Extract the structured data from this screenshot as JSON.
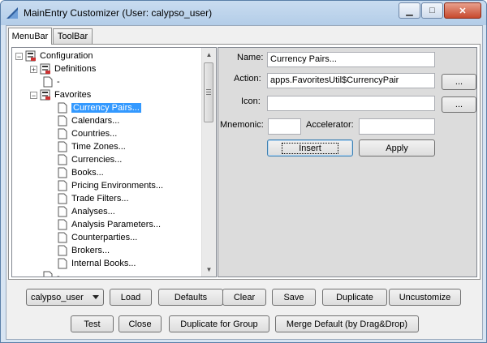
{
  "window": {
    "title": "MainEntry Customizer (User: calypso_user)",
    "minimize_glyph": "▁",
    "maximize_glyph": "□",
    "close_glyph": "✕"
  },
  "tabs": [
    {
      "label": "MenuBar"
    },
    {
      "label": "ToolBar"
    }
  ],
  "tree": {
    "root": "Configuration",
    "definitions": "Definitions",
    "separator": "-",
    "favorites": "Favorites",
    "favorites_items": [
      "Currency Pairs...",
      "Calendars...",
      "Countries...",
      "Time Zones...",
      "Currencies...",
      "Books...",
      "Pricing Environments...",
      "Trade Filters...",
      "Analyses...",
      "Analysis Parameters...",
      "Counterparties...",
      "Brokers...",
      "Internal Books..."
    ],
    "trailing_item": "-"
  },
  "editor": {
    "name_label": "Name:",
    "name_value": "Currency Pairs...",
    "action_label": "Action:",
    "action_value": "apps.FavoritesUtil$CurrencyPair",
    "action_browse": "...",
    "icon_label": "Icon:",
    "icon_value": "",
    "icon_browse": "...",
    "mnemonic_label": "Mnemonic:",
    "mnemonic_value": "",
    "accelerator_label": "Accelerator:",
    "accelerator_value": "",
    "insert_label": "Insert",
    "apply_label": "Apply"
  },
  "bottom": {
    "user_select": "calypso_user",
    "load": "Load",
    "defaults": "Defaults",
    "clear": "Clear",
    "save": "Save",
    "duplicate": "Duplicate",
    "uncustomize": "Uncustomize",
    "test": "Test",
    "close": "Close",
    "duplicate_group": "Duplicate for Group",
    "merge_default": "Merge Default (by Drag&Drop)"
  }
}
